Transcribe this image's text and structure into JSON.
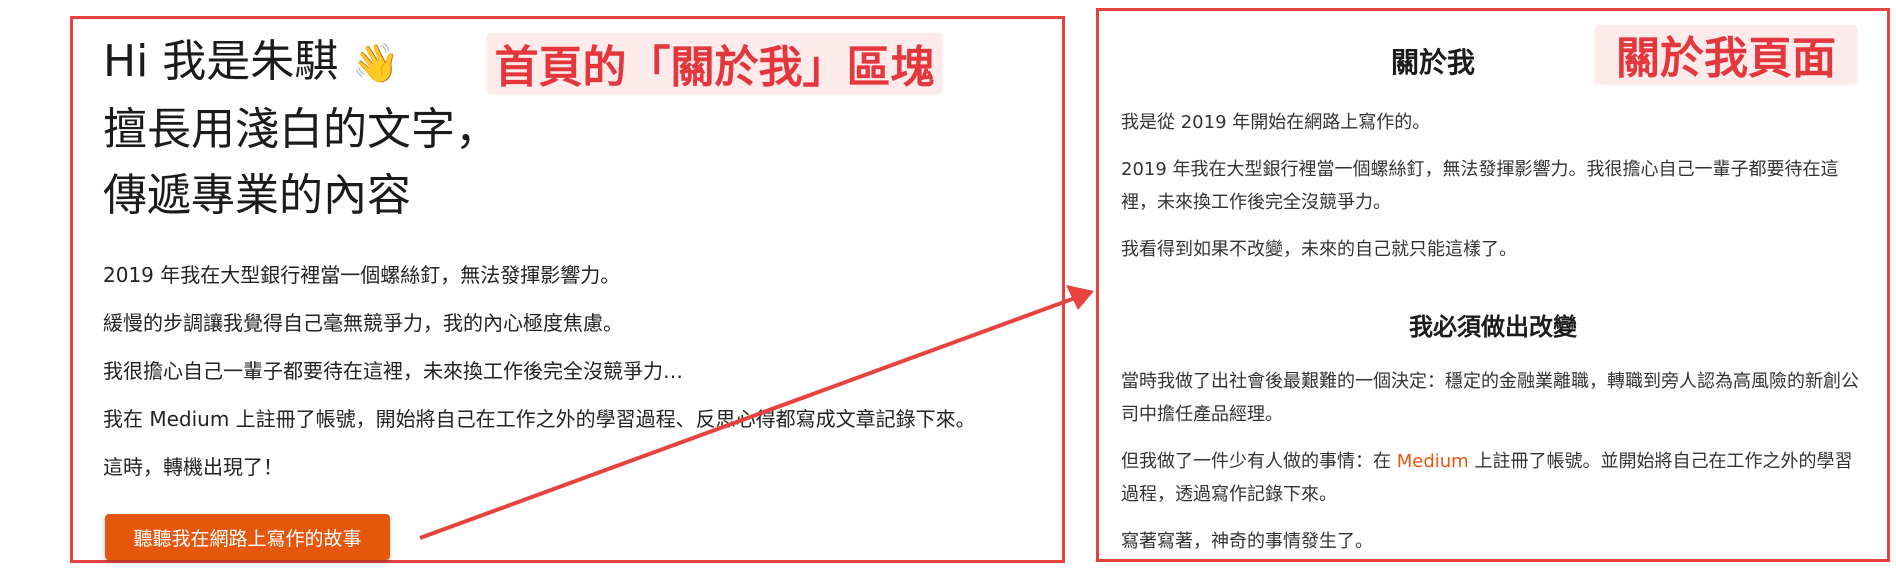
{
  "left_panel": {
    "hero": {
      "line1": "Hi 我是朱騏",
      "wave_emoji": "👋",
      "line2": "擅長用淺白的文字，",
      "line3": "傳遞專業的內容"
    },
    "paragraphs": [
      "2019 年我在大型銀行裡當一個螺絲釘，無法發揮影響力。",
      "緩慢的步調讓我覺得自己毫無競爭力，我的內心極度焦慮。",
      "我很擔心自己一輩子都要待在這裡，未來換工作後完全沒競爭力…",
      "我在 Medium 上註冊了帳號，開始將自己在工作之外的學習過程、反思心得都寫成文章記錄下來。",
      "這時，轉機出現了！"
    ],
    "cta_label": "聽聽我在網路上寫作的故事",
    "annotation_tag": "首頁的「關於我」區塊"
  },
  "right_panel": {
    "title": "關於我",
    "annotation_tag": "關於我頁面",
    "p1": "我是從 2019 年開始在網路上寫作的。",
    "p2": "2019 年我在大型銀行裡當一個螺絲釘，無法發揮影響力。我很擔心自己一輩子都要待在這裡，未來換工作後完全沒競爭力。",
    "p3": "我看得到如果不改變，未來的自己就只能這樣了。",
    "section_title": "我必須做出改變",
    "p4": "當時我做了出社會後最艱難的一個決定：穩定的金融業離職，轉職到旁人認為高風險的新創公司中擔任產品經理。",
    "p5_before": "但我做了一件少有人做的事情：在 ",
    "p5_link": "Medium",
    "p5_after": " 上註冊了帳號。並開始將自己在工作之外的學習過程，透過寫作記錄下來。",
    "p6": "寫著寫著，神奇的事情發生了。"
  },
  "colors": {
    "frame_red": "#e8423f",
    "tag_text": "#e4373d",
    "tag_bg": "#fdeaea",
    "cta_orange": "#e6570e"
  }
}
